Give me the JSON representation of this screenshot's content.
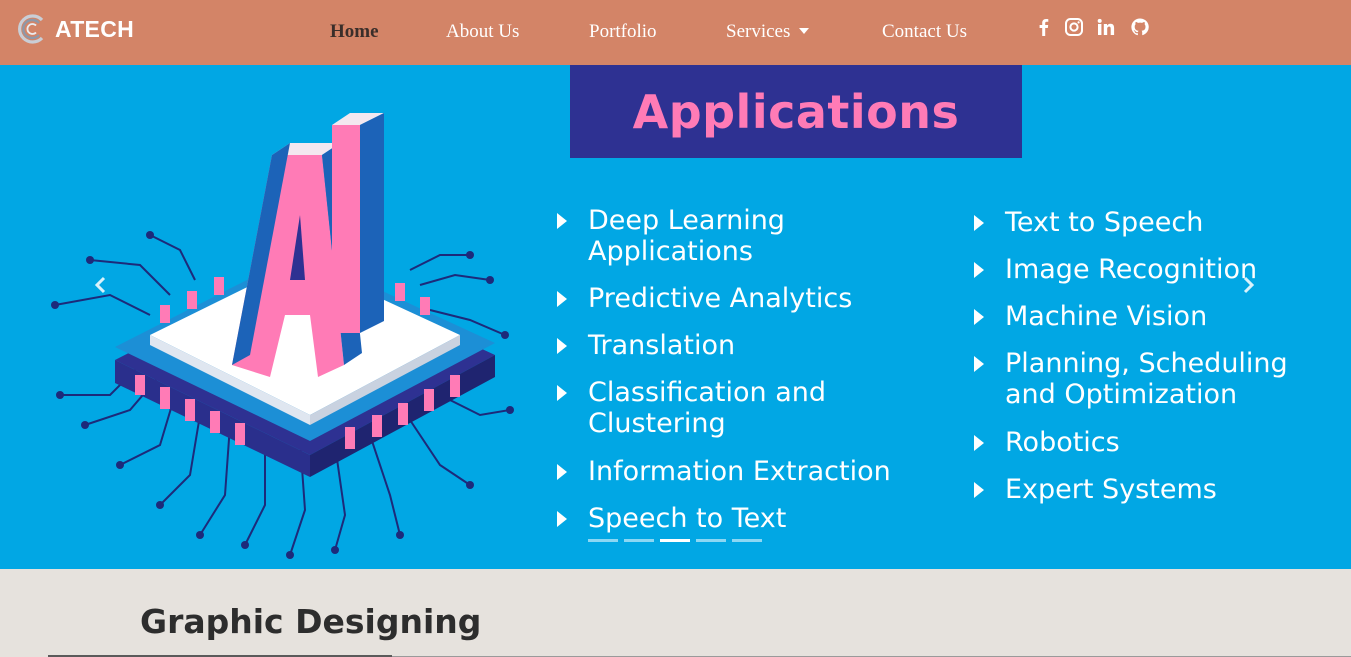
{
  "brand": {
    "name": "ATECH",
    "logo_icon": "swirl-c-logo-icon"
  },
  "nav": {
    "links": [
      {
        "label": "Home",
        "active": true
      },
      {
        "label": "About Us",
        "active": false
      },
      {
        "label": "Portfolio",
        "active": false
      },
      {
        "label": "Services",
        "active": false,
        "dropdown": true
      },
      {
        "label": "Contact Us",
        "active": false
      }
    ],
    "social_icons": [
      "facebook-icon",
      "instagram-icon",
      "linkedin-icon",
      "github-icon"
    ]
  },
  "carousel": {
    "slide": {
      "title": "Applications",
      "left_column": [
        "Deep Learning Applications",
        "Predictive Analytics",
        "Translation",
        "Classification and Clustering",
        "Information Extraction",
        "Speech to Text"
      ],
      "right_column": [
        "Text to Speech",
        "Image Recognition",
        "Machine Vision",
        "Planning, Scheduling and Optimization",
        "Robotics",
        "Expert Systems"
      ],
      "chip_text": "AI"
    },
    "indicator_count": 5,
    "active_indicator": 3,
    "controls": [
      "prev-arrow-icon",
      "next-arrow-icon"
    ]
  },
  "section": {
    "title": "Graphic Designing"
  },
  "colors": {
    "navbar": "#d38467",
    "carousel_bg": "#01a7e4",
    "banner_bg": "#2e3192",
    "banner_text": "#ff7bb6",
    "page_bg": "#e6e2dd",
    "active_nav": "#3a2e2a"
  }
}
